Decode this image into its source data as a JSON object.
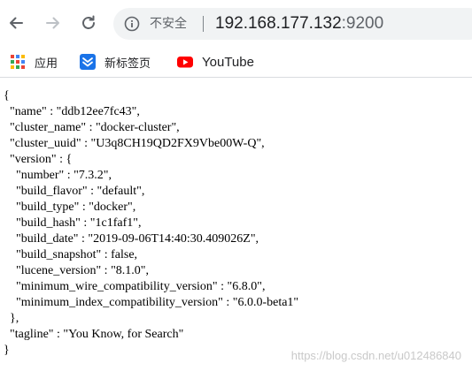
{
  "browser": {
    "security_label": "不安全",
    "url_host": "192.168.177.132",
    "url_port": ":9200",
    "bookmarks": [
      {
        "label": "应用",
        "icon": "apps-grid-icon"
      },
      {
        "label": "新标签页",
        "icon": "new-tab-icon"
      },
      {
        "label": "YouTube",
        "icon": "youtube-icon"
      }
    ]
  },
  "page": {
    "json_lines": [
      "{",
      "  \"name\" : \"ddb12ee7fc43\",",
      "  \"cluster_name\" : \"docker-cluster\",",
      "  \"cluster_uuid\" : \"U3q8CH19QD2FX9Vbe00W-Q\",",
      "  \"version\" : {",
      "    \"number\" : \"7.3.2\",",
      "    \"build_flavor\" : \"default\",",
      "    \"build_type\" : \"docker\",",
      "    \"build_hash\" : \"1c1faf1\",",
      "    \"build_date\" : \"2019-09-06T14:40:30.409026Z\",",
      "    \"build_snapshot\" : false,",
      "    \"lucene_version\" : \"8.1.0\",",
      "    \"minimum_wire_compatibility_version\" : \"6.8.0\",",
      "    \"minimum_index_compatibility_version\" : \"6.0.0-beta1\"",
      "  },",
      "  \"tagline\" : \"You Know, for Search\"",
      "}"
    ],
    "watermark": "https://blog.csdn.net/u012486840"
  }
}
